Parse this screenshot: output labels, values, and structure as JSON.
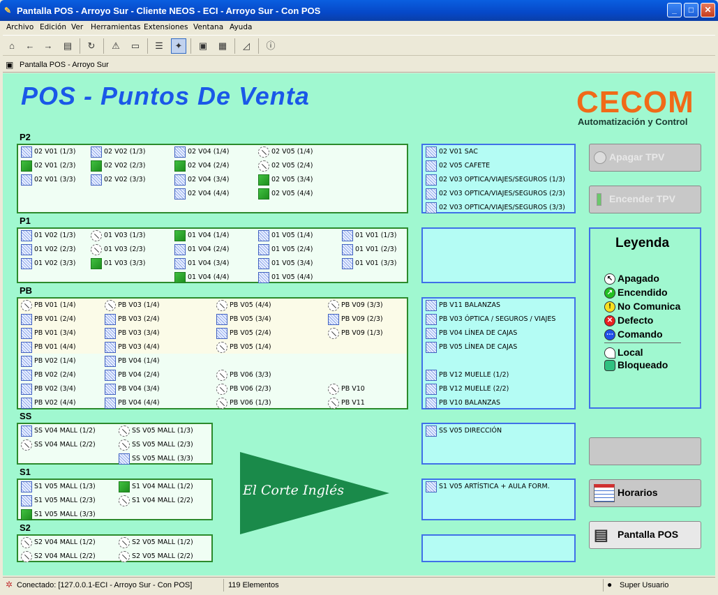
{
  "window": {
    "title": "Pantalla POS - Arroyo Sur - Cliente NEOS - ECI - Arroyo Sur - Con POS"
  },
  "menu": [
    "Archivo",
    "Edición",
    "Ver",
    "Herramientas",
    "Extensiones",
    "Ventana",
    "Ayuda"
  ],
  "tab": {
    "label": "Pantalla POS - Arroyo Sur"
  },
  "header": {
    "title": "POS - Puntos De Venta",
    "logo_text": "CECOM",
    "logo_sub": "Automatización y Control"
  },
  "sections": {
    "p2": "P2",
    "p1": "P1",
    "pb": "PB",
    "ss": "SS",
    "s1": "S1",
    "s2": "S2"
  },
  "p2": [
    {
      "label": "02 V01 (1/3)",
      "st": "net"
    },
    {
      "label": "02 V01 (2/3)",
      "st": "on"
    },
    {
      "label": "02 V01 (3/3)",
      "st": "net"
    },
    {
      "label": "02 V02 (1/3)",
      "st": "net"
    },
    {
      "label": "02 V02 (2/3)",
      "st": "on"
    },
    {
      "label": "02 V02 (3/3)",
      "st": "net"
    },
    {
      "label": "02 V04 (1/4)",
      "st": "net"
    },
    {
      "label": "02 V04 (2/4)",
      "st": "on"
    },
    {
      "label": "02 V04 (3/4)",
      "st": "net"
    },
    {
      "label": "02 V04 (4/4)",
      "st": "net"
    },
    {
      "label": "02 V05 (1/4)",
      "st": "off"
    },
    {
      "label": "02 V05 (2/4)",
      "st": "off"
    },
    {
      "label": "02 V05 (3/4)",
      "st": "on"
    },
    {
      "label": "02 V05 (4/4)",
      "st": "on"
    }
  ],
  "p2_right": [
    "02 V01 SAC",
    "02 V05 CAFETE",
    "02 V03 OPTICA/VIAJES/SEGUROS (1/3)",
    "02 V03 OPTICA/VIAJES/SEGUROS (2/3)",
    "02 V03 OPTICA/VIAJES/SEGUROS (3/3)"
  ],
  "p1": [
    {
      "label": "01 V02 (1/3)",
      "st": "net"
    },
    {
      "label": "01 V02 (2/3)",
      "st": "net"
    },
    {
      "label": "01 V02 (3/3)",
      "st": "net"
    },
    {
      "label": "01 V03 (1/3)",
      "st": "off"
    },
    {
      "label": "01 V03 (2/3)",
      "st": "off"
    },
    {
      "label": "01 V03 (3/3)",
      "st": "on"
    },
    {
      "label": "01 V04 (1/4)",
      "st": "on"
    },
    {
      "label": "01 V04 (2/4)",
      "st": "net"
    },
    {
      "label": "01 V04 (3/4)",
      "st": "net"
    },
    {
      "label": "01 V04 (4/4)",
      "st": "on"
    },
    {
      "label": "01 V05 (1/4)",
      "st": "net"
    },
    {
      "label": "01 V05 (2/4)",
      "st": "net"
    },
    {
      "label": "01 V05 (3/4)",
      "st": "net"
    },
    {
      "label": "01 V05 (4/4)",
      "st": "net"
    },
    {
      "label": "01 V01 (1/3)",
      "st": "net"
    },
    {
      "label": "01 V01 (2/3)",
      "st": "net"
    },
    {
      "label": "01 V01 (3/3)",
      "st": "net"
    }
  ],
  "pb": [
    {
      "label": "PB V01 (1/4)",
      "st": "off"
    },
    {
      "label": "PB V01 (2/4)",
      "st": "net"
    },
    {
      "label": "PB V01 (3/4)",
      "st": "net"
    },
    {
      "label": "PB V01 (4/4)",
      "st": "net"
    },
    {
      "label": "PB V02 (1/4)",
      "st": "net"
    },
    {
      "label": "PB V02 (2/4)",
      "st": "net"
    },
    {
      "label": "PB V02 (3/4)",
      "st": "net"
    },
    {
      "label": "PB V02 (4/4)",
      "st": "net"
    },
    {
      "label": "PB V03 (1/4)",
      "st": "off"
    },
    {
      "label": "PB V03 (2/4)",
      "st": "net"
    },
    {
      "label": "PB V03 (3/4)",
      "st": "net"
    },
    {
      "label": "PB V03 (4/4)",
      "st": "net"
    },
    {
      "label": "PB V04 (1/4)",
      "st": "net"
    },
    {
      "label": "PB V04 (2/4)",
      "st": "net"
    },
    {
      "label": "PB V04 (3/4)",
      "st": "net"
    },
    {
      "label": "PB V04 (4/4)",
      "st": "net"
    },
    {
      "label": "PB V05 (4/4)",
      "st": "off"
    },
    {
      "label": "PB V05 (3/4)",
      "st": "net"
    },
    {
      "label": "PB V05 (2/4)",
      "st": "net"
    },
    {
      "label": "PB V05 (1/4)",
      "st": "off"
    },
    {
      "label": "PB V06 (3/3)",
      "st": "off"
    },
    {
      "label": "PB V06 (2/3)",
      "st": "off"
    },
    {
      "label": "PB V06 (1/3)",
      "st": "off"
    },
    {
      "label": "PB V09 (3/3)",
      "st": "off"
    },
    {
      "label": "PB V09 (2/3)",
      "st": "net"
    },
    {
      "label": "PB V09 (1/3)",
      "st": "off"
    },
    {
      "label": "PB V10",
      "st": "off"
    },
    {
      "label": "PB V11",
      "st": "off"
    }
  ],
  "pb_right": [
    "PB V11 BALANZAS",
    "PB V03 ÓPTICA / SEGUROS / VIAJES",
    "PB V04 LÍNEA DE CAJAS",
    "PB V05 LÍNEA DE CAJAS",
    "PB V12 MUELLE (1/2)",
    "PB V12 MUELLE (2/2)",
    "PB V10 BALANZAS"
  ],
  "ss": [
    {
      "label": "SS V04 MALL (1/2)",
      "st": "net"
    },
    {
      "label": "SS V04 MALL (2/2)",
      "st": "off"
    },
    {
      "label": "SS V05 MALL (1/3)",
      "st": "off"
    },
    {
      "label": "SS V05 MALL (2/3)",
      "st": "off"
    },
    {
      "label": "SS V05 MALL (3/3)",
      "st": "net"
    }
  ],
  "ss_right": [
    "SS V05 DIRECCIÓN"
  ],
  "s1": [
    {
      "label": "S1 V05 MALL (1/3)",
      "st": "net"
    },
    {
      "label": "S1 V05 MALL (2/3)",
      "st": "net"
    },
    {
      "label": "S1 V05 MALL (3/3)",
      "st": "on"
    },
    {
      "label": "S1 V04 MALL (1/2)",
      "st": "on"
    },
    {
      "label": "S1 V04 MALL (2/2)",
      "st": "off"
    }
  ],
  "s1_right": [
    "S1 V05 ARTÍSTICA + AULA FORM."
  ],
  "s2": [
    {
      "label": "S2 V04 MALL (1/2)",
      "st": "off"
    },
    {
      "label": "S2 V04 MALL (2/2)",
      "st": "off"
    },
    {
      "label": "S2 V05 MALL (1/2)",
      "st": "off"
    },
    {
      "label": "S2 V05 MALL (2/2)",
      "st": "off"
    }
  ],
  "buttons": {
    "apagar": "Apagar TPV",
    "encender": "Encender TPV",
    "horarios": "Horarios",
    "pantalla": "Pantalla POS"
  },
  "legend": {
    "title": "Leyenda",
    "items": [
      {
        "label": "Apagado",
        "color": "#ffffff"
      },
      {
        "label": "Encendido",
        "color": "#22c022"
      },
      {
        "label": "No Comunica",
        "color": "#f8e020"
      },
      {
        "label": "Defecto",
        "color": "#e82020"
      },
      {
        "label": "Comando",
        "color": "#2050e8"
      },
      {
        "label": "Local",
        "color": "#ffffff"
      },
      {
        "label": "Bloqueado",
        "color": "#30c080"
      }
    ]
  },
  "banner": {
    "text": "El Corte Inglés",
    "color": "#1a8a4a"
  },
  "status": {
    "connection": "Conectado: [127.0.0.1-ECI - Arroyo Sur - Con POS]",
    "count": "119 Elementos",
    "user": "Super Usuario"
  }
}
